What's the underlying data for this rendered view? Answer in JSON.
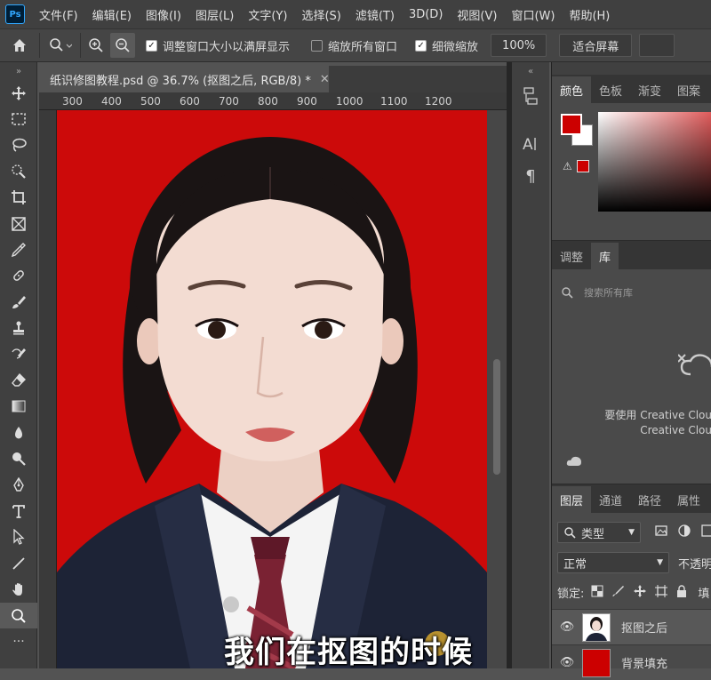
{
  "app": {
    "logo": "Ps"
  },
  "menu": [
    "文件(F)",
    "编辑(E)",
    "图像(I)",
    "图层(L)",
    "文字(Y)",
    "选择(S)",
    "滤镜(T)",
    "3D(D)",
    "视图(V)",
    "窗口(W)",
    "帮助(H)"
  ],
  "options": {
    "resize_windows_label": "调整窗口大小以满屏显示",
    "resize_windows_checked": true,
    "zoom_all_label": "缩放所有窗口",
    "zoom_all_checked": false,
    "scrubby_label": "细微缩放",
    "scrubby_checked": true,
    "zoom_value": "100%",
    "fit_screen_label": "适合屏幕"
  },
  "document": {
    "tab_title": "纸识修图教程.psd @ 36.7% (抠图之后, RGB/8) *"
  },
  "ruler": {
    "h_ticks": [
      "300",
      "400",
      "500",
      "600",
      "700",
      "800",
      "900",
      "1000",
      "1100",
      "1200"
    ]
  },
  "subtitle": "我们在抠图的时候",
  "color_panel": {
    "tabs": [
      "颜色",
      "色板",
      "渐变",
      "图案"
    ],
    "foreground": "#cc0000",
    "background": "#ffffff"
  },
  "libraries": {
    "tabs": [
      "调整",
      "库"
    ],
    "search_placeholder": "搜索所有库",
    "message_line1": "要使用 Creative Clou",
    "message_line2": "Creative Clou"
  },
  "layers": {
    "tabs": [
      "图层",
      "通道",
      "路径",
      "属性"
    ],
    "filter_label": "类型",
    "blend_mode": "正常",
    "opacity_label": "不透明",
    "lock_label": "锁定:",
    "fill_label": "填",
    "items": [
      {
        "name": "抠图之后",
        "visible": true,
        "selected": true
      },
      {
        "name": "背景填充",
        "visible": true,
        "selected": false
      }
    ]
  },
  "colors": {
    "canvas_red": "#cc0a0a"
  }
}
